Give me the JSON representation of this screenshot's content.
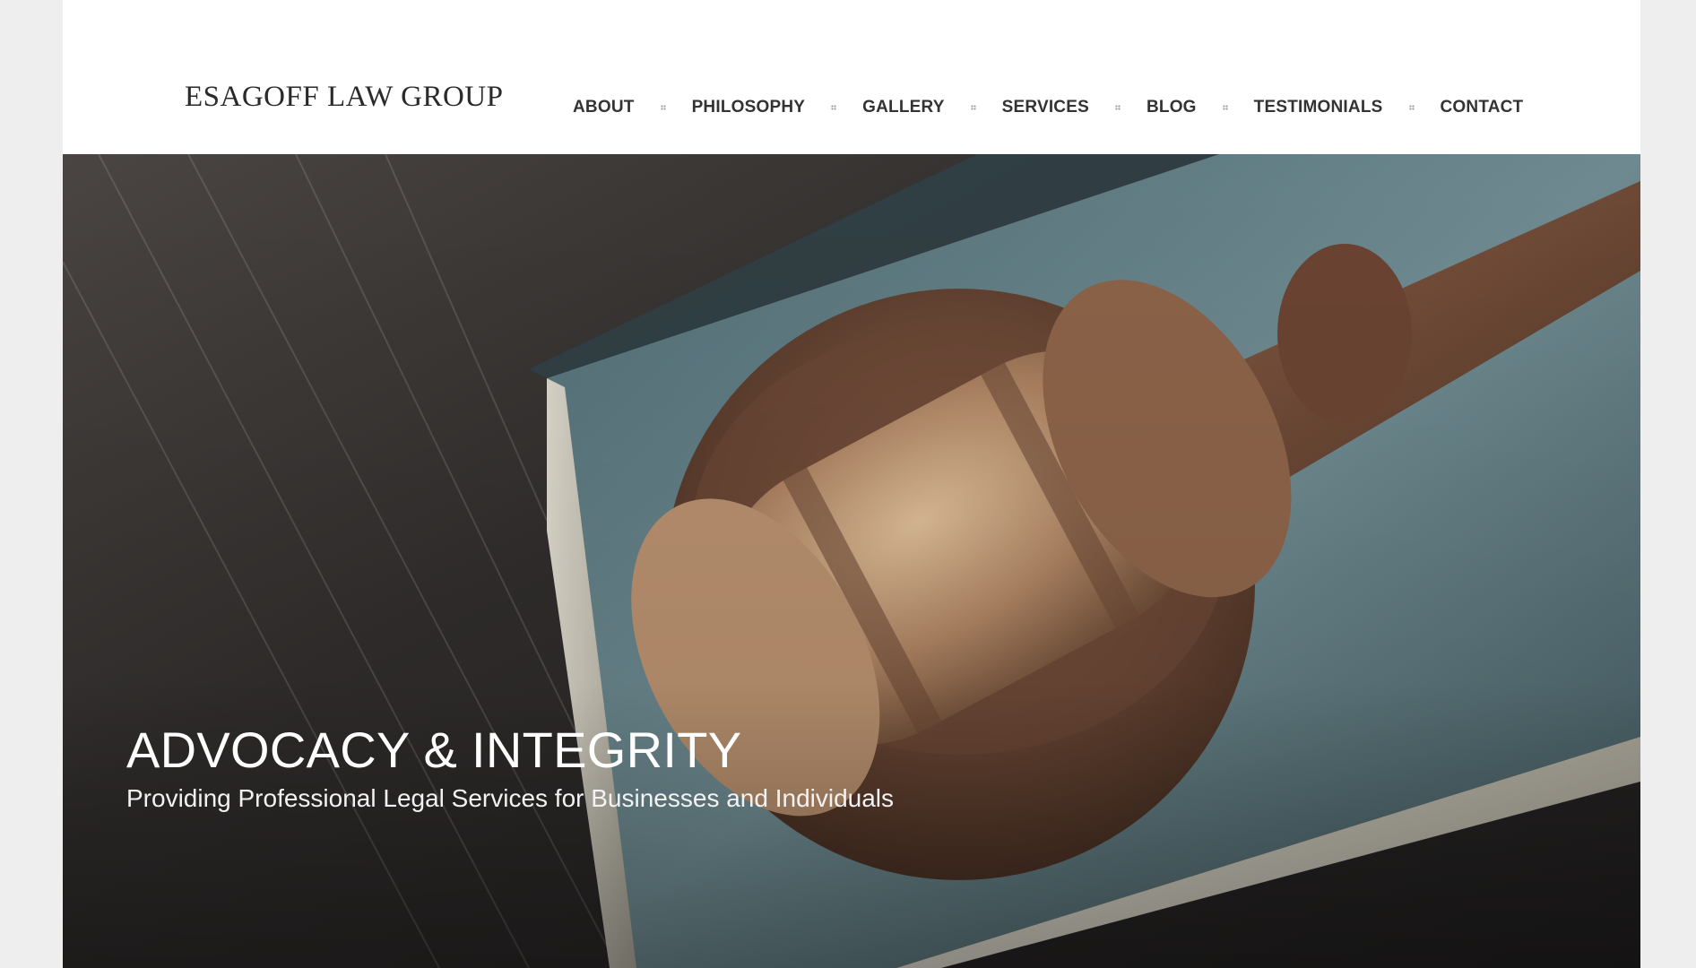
{
  "brand": {
    "logo_text": "ESAGOFF LAW GROUP"
  },
  "nav": {
    "items": [
      {
        "label": "ABOUT"
      },
      {
        "label": "PHILOSOPHY"
      },
      {
        "label": "GALLERY"
      },
      {
        "label": "SERVICES"
      },
      {
        "label": "BLOG"
      },
      {
        "label": "TESTIMONIALS"
      },
      {
        "label": "CONTACT"
      }
    ]
  },
  "hero": {
    "title": "ADVOCACY & INTEGRITY",
    "subtitle": "Providing Professional Legal Services for Businesses and Individuals",
    "image_subject": "gavel-on-book-photo"
  },
  "colors": {
    "page_bg": "#eeeeee",
    "header_bg": "#ffffff",
    "nav_text": "#333333",
    "hero_text": "#ffffff"
  }
}
